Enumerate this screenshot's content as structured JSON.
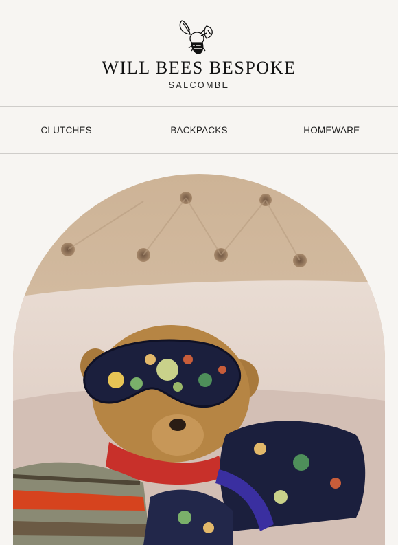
{
  "brand": {
    "name": "WILL BEES BESPOKE",
    "location": "SALCOMBE",
    "logo_icon": "bee-icon"
  },
  "nav": {
    "items": [
      {
        "label": "CLUTCHES"
      },
      {
        "label": "BACKPACKS"
      },
      {
        "label": "HOMEWARE"
      }
    ]
  },
  "hero": {
    "image": "teddy-bear-with-silk-eye-mask-photo"
  },
  "colors": {
    "background": "#f7f5f2",
    "text": "#1a1a1a",
    "divider": "#cfcdca"
  }
}
